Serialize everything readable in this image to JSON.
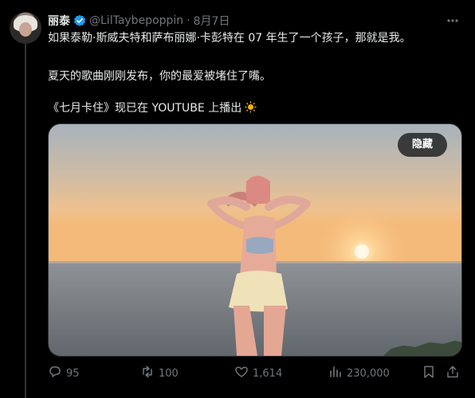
{
  "tweet": {
    "author_name": "丽泰",
    "handle": "@LilTaybepoppin",
    "separator": "·",
    "date": "8月7日",
    "lines": [
      "如果泰勒·斯威夫特和萨布丽娜·卡彭特在 07 年生了一个孩子，那就是我。",
      "夏天的歌曲刚刚发布，你的最爱被堵住了嘴。",
      "《七月卡住》现已在 YOUTUBE 上播出"
    ],
    "emoji_icon": "sun-emoji",
    "hide_label": "隐藏",
    "metrics": {
      "replies": "95",
      "retweets": "100",
      "likes": "1,614",
      "views": "230,000"
    }
  },
  "colors": {
    "background": "#000000",
    "text": "#e7e9ea",
    "muted": "#71767b",
    "verified": "#1d9bf0"
  }
}
